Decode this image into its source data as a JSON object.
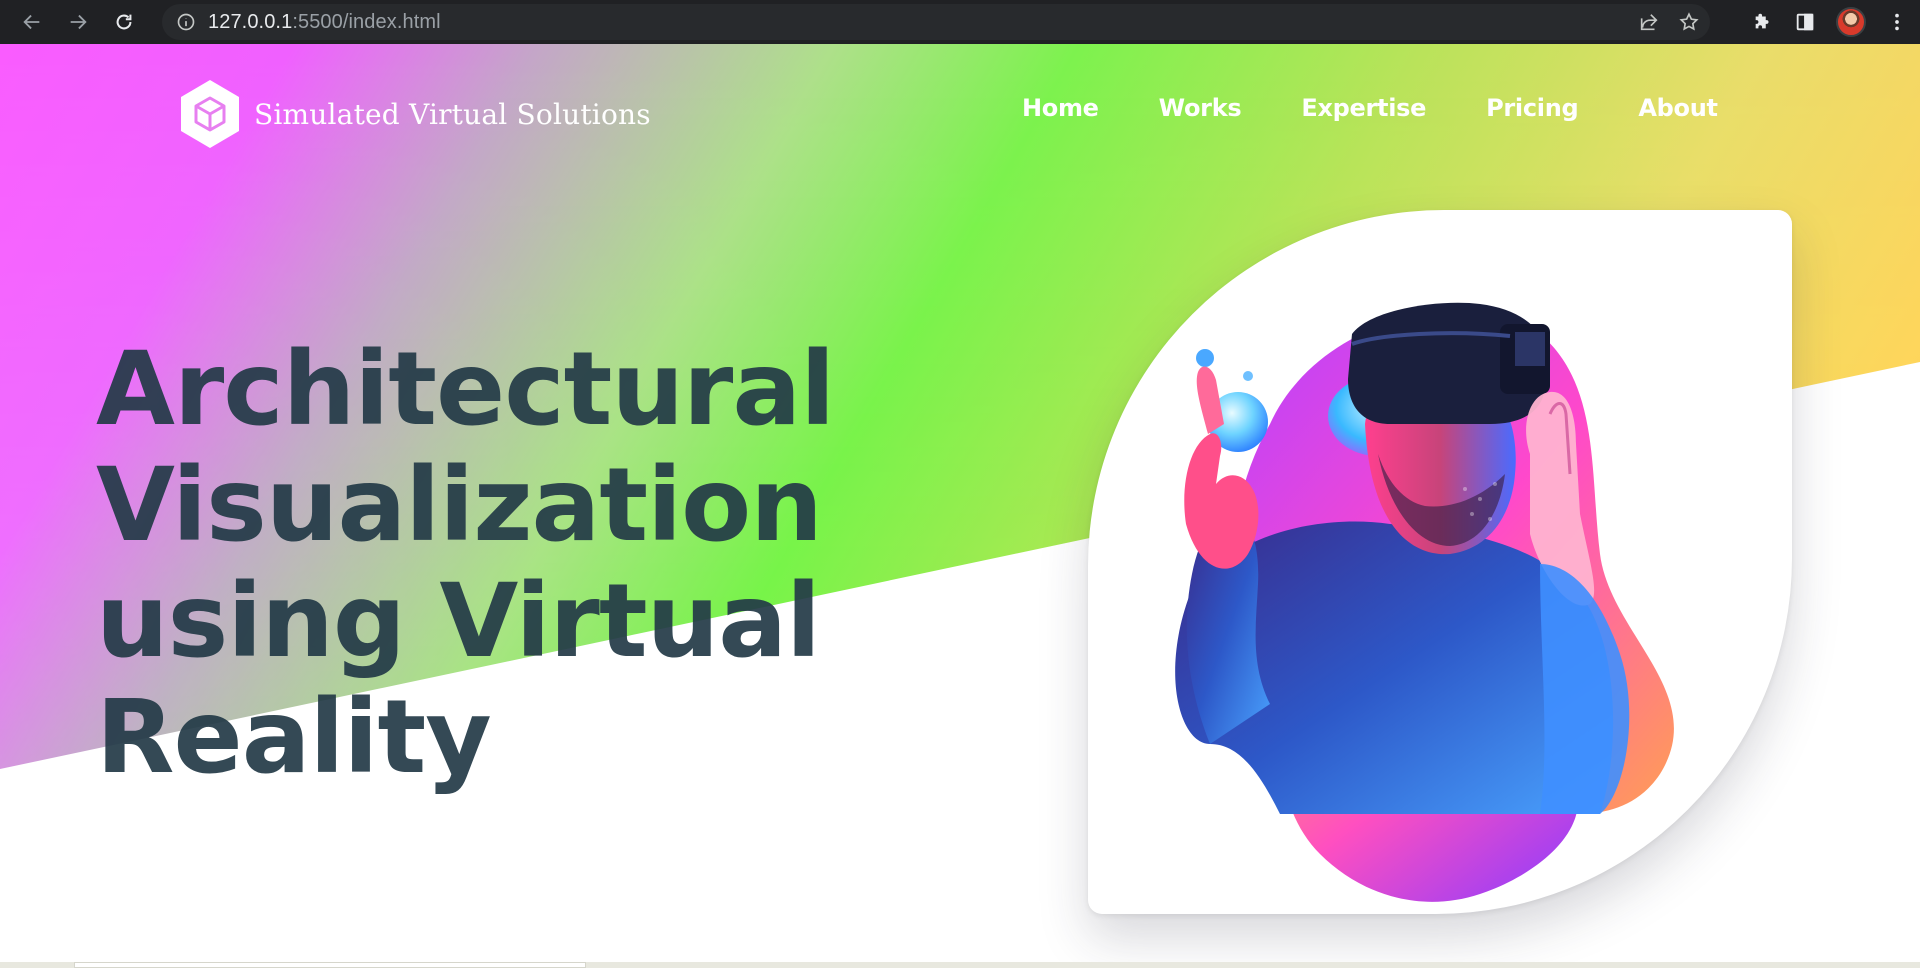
{
  "browser": {
    "url_host": "127.0.0.1",
    "url_path": ":5500/index.html",
    "icons": {
      "back": "arrow-left-icon",
      "forward": "arrow-right-icon",
      "reload": "reload-icon",
      "site_info": "info-icon",
      "share": "share-icon",
      "bookmark": "star-icon",
      "extensions": "puzzle-icon",
      "side_panel": "side-panel-icon",
      "profile": "avatar",
      "menu": "kebab-menu-icon"
    }
  },
  "header": {
    "brand_name": "Simulated Virtual Solutions",
    "logo_icon": "cube-hexagon-icon",
    "nav": [
      {
        "label": "Home"
      },
      {
        "label": "Works"
      },
      {
        "label": "Expertise"
      },
      {
        "label": "Pricing"
      },
      {
        "label": "About"
      }
    ]
  },
  "hero": {
    "title_lines": [
      "Architectural",
      "Visualization",
      "using Virtual",
      "Reality"
    ],
    "image": "vr-headset-person-illustration"
  },
  "colors": {
    "gradient_magenta": "#fa5cff",
    "gradient_green": "#7df24e",
    "gradient_yellow": "#ffcc55",
    "title_text": "#233a47",
    "nav_text": "#ffffff"
  }
}
